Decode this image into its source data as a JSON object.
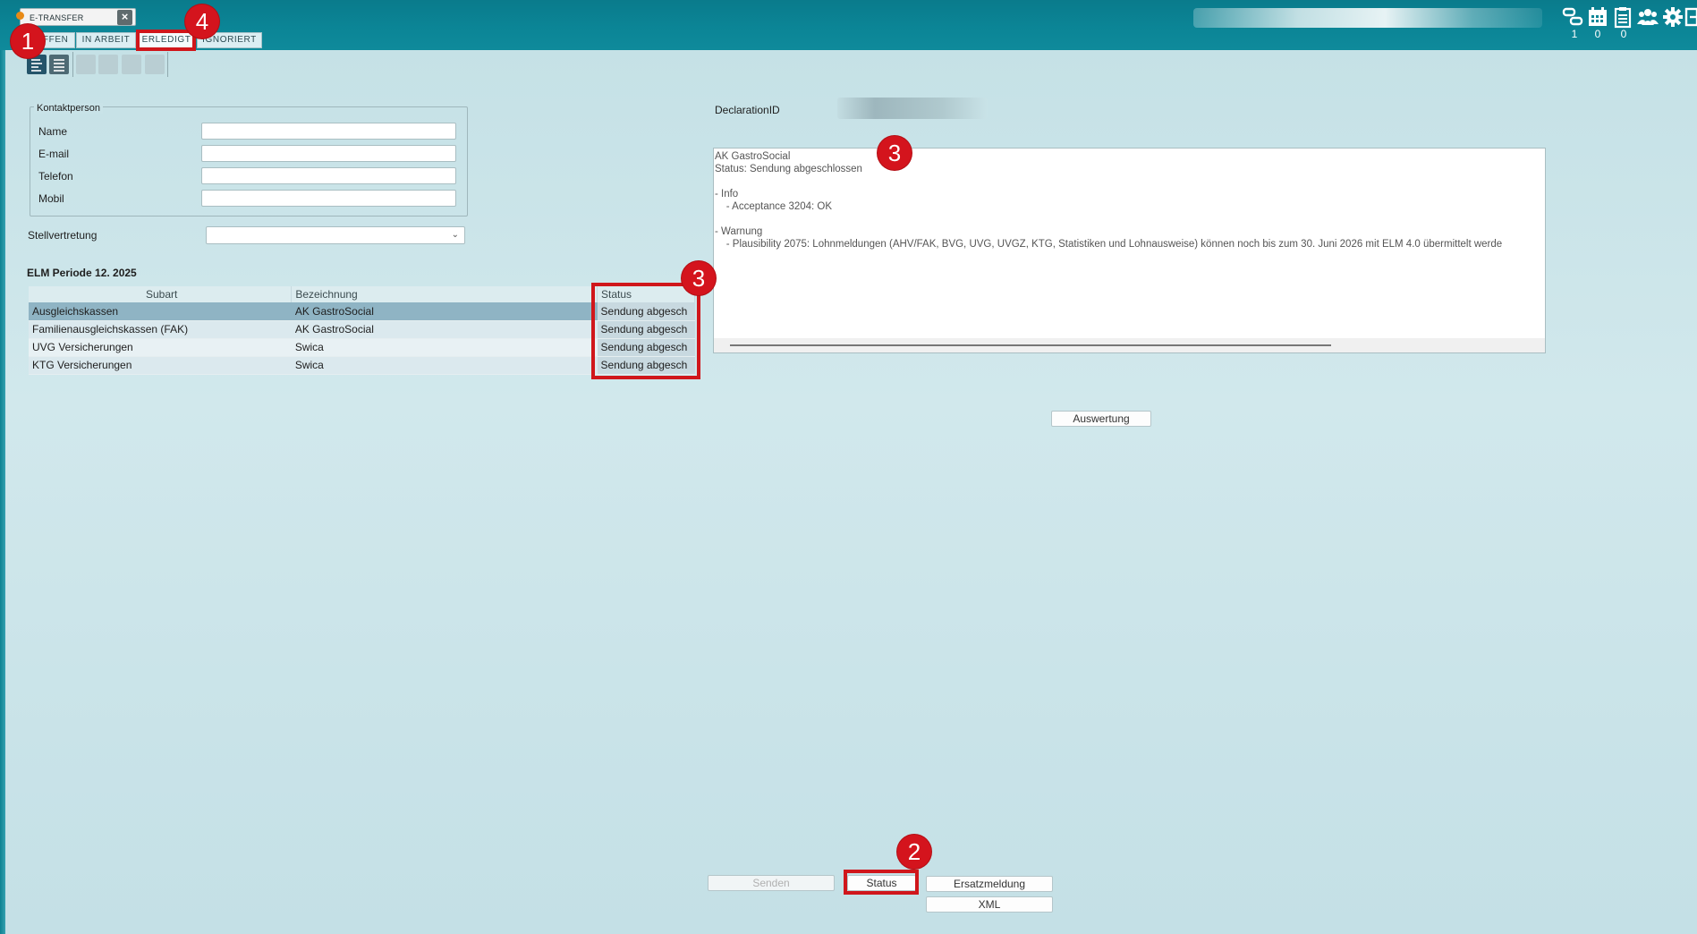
{
  "window_tab": {
    "title": "E-TRANSFER",
    "close_icon": "close-icon"
  },
  "filter_tabs": [
    {
      "label": "OFFEN"
    },
    {
      "label": "IN ARBEIT"
    },
    {
      "label": "ERLEDIGT"
    },
    {
      "label": "IGNORIERT"
    }
  ],
  "toolbar_counts": {
    "a": "1",
    "b": "0",
    "c": "0"
  },
  "toolbar_icons": [
    "route-icon",
    "calendar-icon",
    "clipboard-icon",
    "users-icon",
    "gear-icon",
    "logout-icon"
  ],
  "view_buttons": [
    "detail-view-icon",
    "list-view-icon"
  ],
  "contact": {
    "legend": "Kontaktperson",
    "name_label": "Name",
    "email_label": "E-mail",
    "phone_label": "Telefon",
    "mobile_label": "Mobil",
    "name_value": "",
    "email_value": "",
    "phone_value": "",
    "mobile_value": ""
  },
  "stellvertretung": {
    "label": "Stellvertretung",
    "value": ""
  },
  "elm": {
    "title": "ELM Periode 12. 2025",
    "columns": [
      "Subart",
      "Bezeichnung",
      "Status"
    ],
    "rows": [
      {
        "subart": "Ausgleichskassen",
        "bezeichnung": "AK GastroSocial",
        "status": "Sendung abgesch"
      },
      {
        "subart": "Familienausgleichskassen (FAK)",
        "bezeichnung": "AK GastroSocial",
        "status": "Sendung abgesch"
      },
      {
        "subart": "UVG Versicherungen",
        "bezeichnung": "Swica",
        "status": "Sendung abgesch"
      },
      {
        "subart": "KTG Versicherungen",
        "bezeichnung": "Swica",
        "status": "Sendung abgesch"
      }
    ]
  },
  "declaration": {
    "label": "DeclarationID"
  },
  "log_lines": [
    "AK GastroSocial",
    "Status: Sendung abgeschlossen",
    "",
    "- Info",
    "    - Acceptance 3204: OK",
    "",
    "- Warnung",
    "    - Plausibility 2075: Lohnmeldungen (AHV/FAK, BVG, UVG, UVGZ, KTG, Statistiken und Lohnausweise) können noch bis zum 30. Juni 2026 mit ELM 4.0 übermittelt werde"
  ],
  "buttons": {
    "auswertung": "Auswertung",
    "senden": "Senden",
    "status": "Status",
    "ersatzmeldung": "Ersatzmeldung",
    "xml": "XML"
  },
  "markers": {
    "m1": "1",
    "m2": "2",
    "m3a": "3",
    "m3b": "3",
    "m4": "4"
  },
  "colors": {
    "topbar": "#0a7b8c",
    "background": "#c9e3e8",
    "highlight": "#d0161b",
    "selected_row": "#8fb4c4"
  }
}
